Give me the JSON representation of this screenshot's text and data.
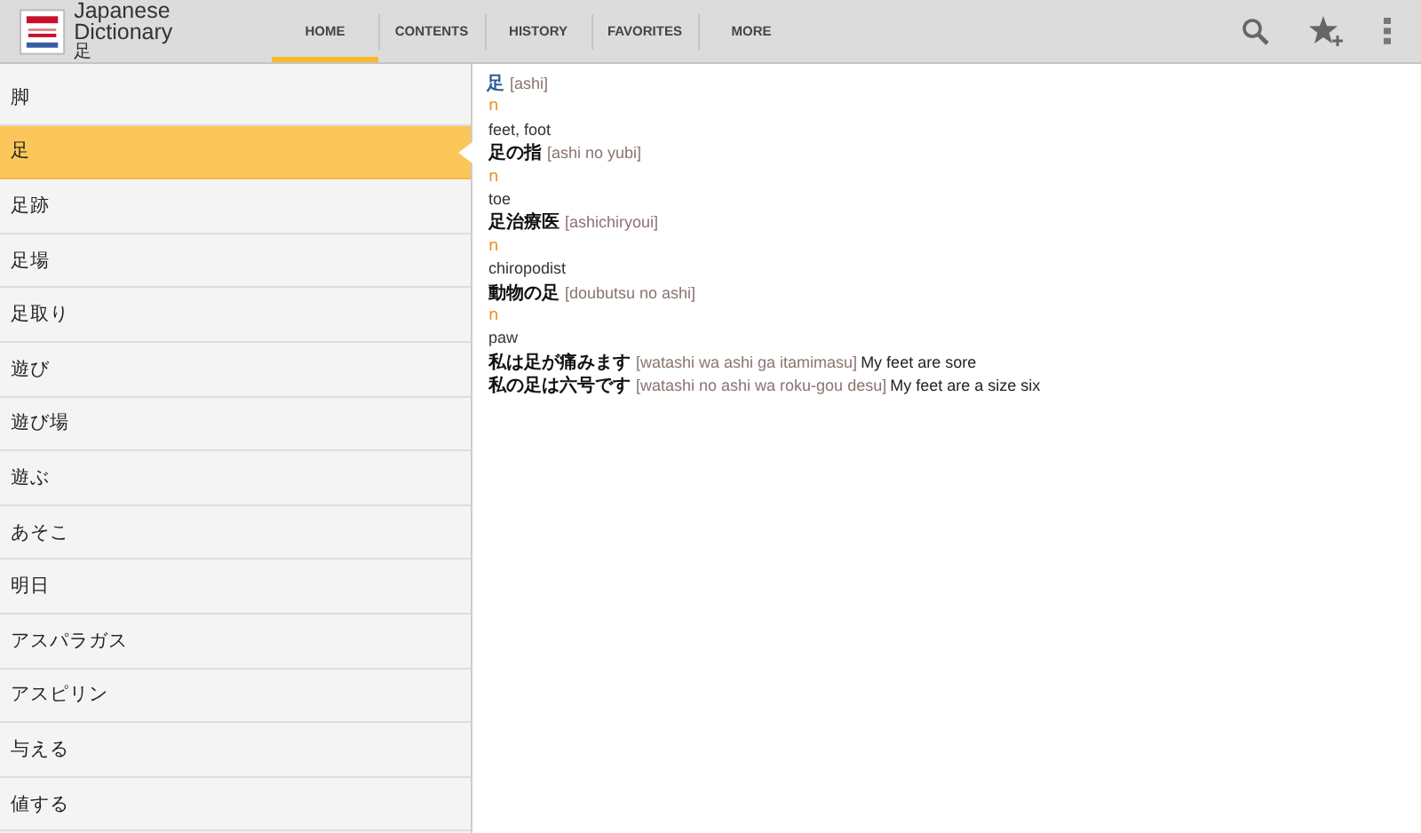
{
  "app_bar": {
    "title": "Japanese Dictionary",
    "subtitle": "足"
  },
  "tabs": [
    {
      "label": "HOME",
      "selected": true
    },
    {
      "label": "CONTENTS",
      "selected": false
    },
    {
      "label": "HISTORY",
      "selected": false
    },
    {
      "label": "FAVORITES",
      "selected": false
    },
    {
      "label": "MORE",
      "selected": false
    }
  ],
  "word_list": [
    {
      "label": "脚",
      "selected": false
    },
    {
      "label": "足",
      "selected": true
    },
    {
      "label": "足跡",
      "selected": false
    },
    {
      "label": "足場",
      "selected": false
    },
    {
      "label": "足取り",
      "selected": false
    },
    {
      "label": "遊び",
      "selected": false
    },
    {
      "label": "遊び場",
      "selected": false
    },
    {
      "label": "遊ぶ",
      "selected": false
    },
    {
      "label": "あそこ",
      "selected": false
    },
    {
      "label": "明日",
      "selected": false
    },
    {
      "label": "アスパラガス",
      "selected": false
    },
    {
      "label": "アスピリン",
      "selected": false
    },
    {
      "label": "与える",
      "selected": false
    },
    {
      "label": "値する",
      "selected": false
    }
  ],
  "entry": [
    {
      "kind": "headword",
      "text": "足",
      "reading": "[ashi]"
    },
    {
      "kind": "pos",
      "text": "n"
    },
    {
      "kind": "gloss",
      "text": "feet, foot"
    },
    {
      "kind": "phrase",
      "text": "足の指",
      "reading": "[ashi no yubi]"
    },
    {
      "kind": "pos",
      "text": "n"
    },
    {
      "kind": "gloss",
      "text": "toe"
    },
    {
      "kind": "phrase",
      "text": "足治療医",
      "reading": "[ashichiryoui]"
    },
    {
      "kind": "pos",
      "text": "n"
    },
    {
      "kind": "gloss",
      "text": "chiropodist"
    },
    {
      "kind": "phrase",
      "text": "動物の足",
      "reading": "[doubutsu no ashi]"
    },
    {
      "kind": "pos",
      "text": "n"
    },
    {
      "kind": "gloss",
      "text": "paw"
    },
    {
      "kind": "phrase",
      "text": "私は足が痛みます",
      "reading": "[watashi wa ashi ga itamimasu]",
      "translation": "My feet are sore"
    },
    {
      "kind": "phrase",
      "text": "私の足は六号です",
      "reading": "[watashi no ashi wa roku-gou desu]",
      "translation": "My feet are a size six"
    }
  ]
}
